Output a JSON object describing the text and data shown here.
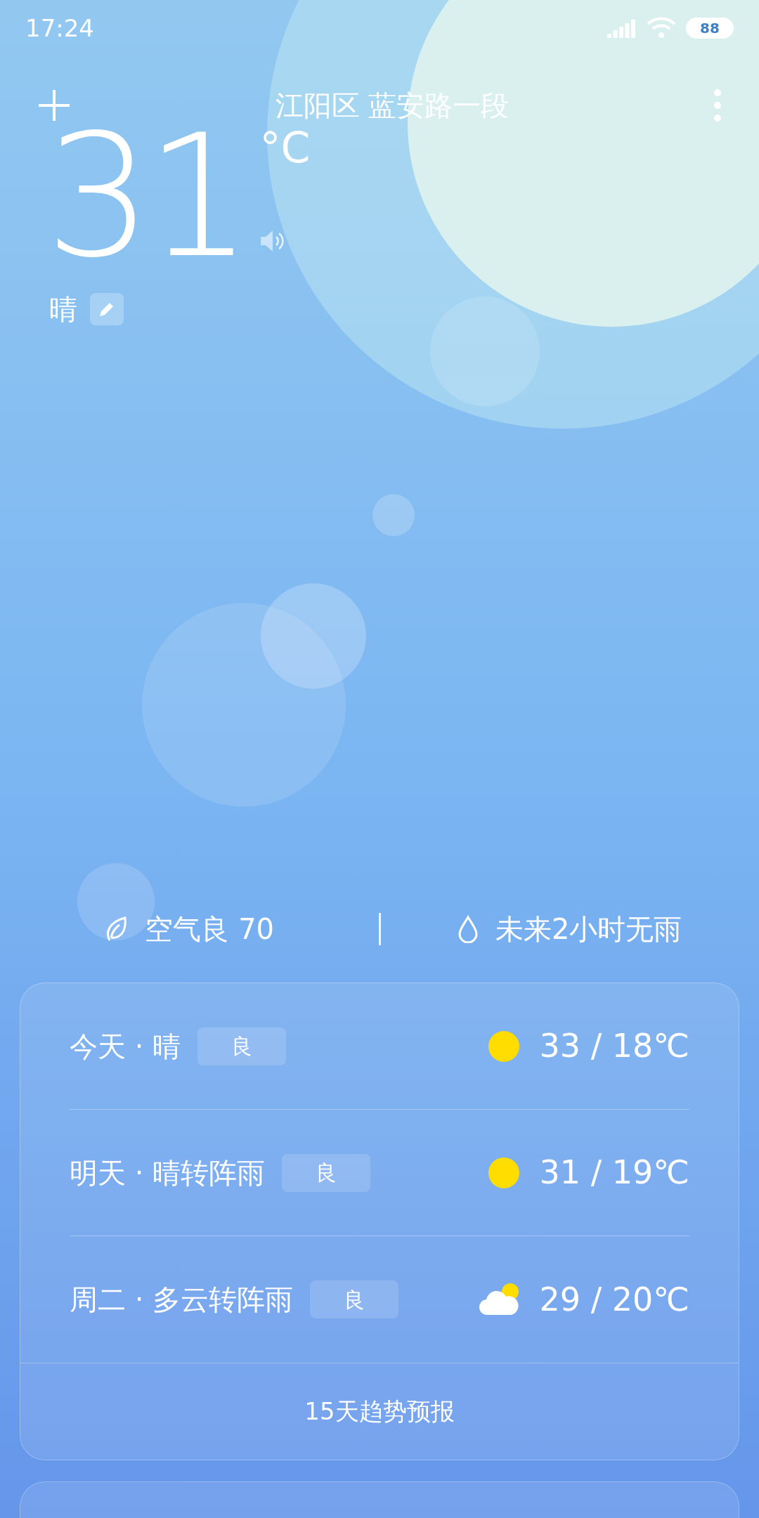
{
  "status_bar": {
    "time": "17:24",
    "battery": "88"
  },
  "header": {
    "location": "江阳区 蓝安路一段"
  },
  "current": {
    "temperature": "31",
    "unit": "°C",
    "condition": "晴"
  },
  "summary": {
    "air": "空气良 70",
    "rain": "未来2小时无雨"
  },
  "forecast": {
    "days": [
      {
        "label": "今天 · 晴",
        "quality": "良",
        "kind": "sunny",
        "temps": "33 / 18℃"
      },
      {
        "label": "明天 · 晴转阵雨",
        "quality": "良",
        "kind": "sunny",
        "temps": "31 / 19℃"
      },
      {
        "label": "周二 · 多云转阵雨",
        "quality": "良",
        "kind": "cloudy",
        "temps": "29 / 20℃"
      }
    ],
    "more": "15天趋势预报"
  }
}
